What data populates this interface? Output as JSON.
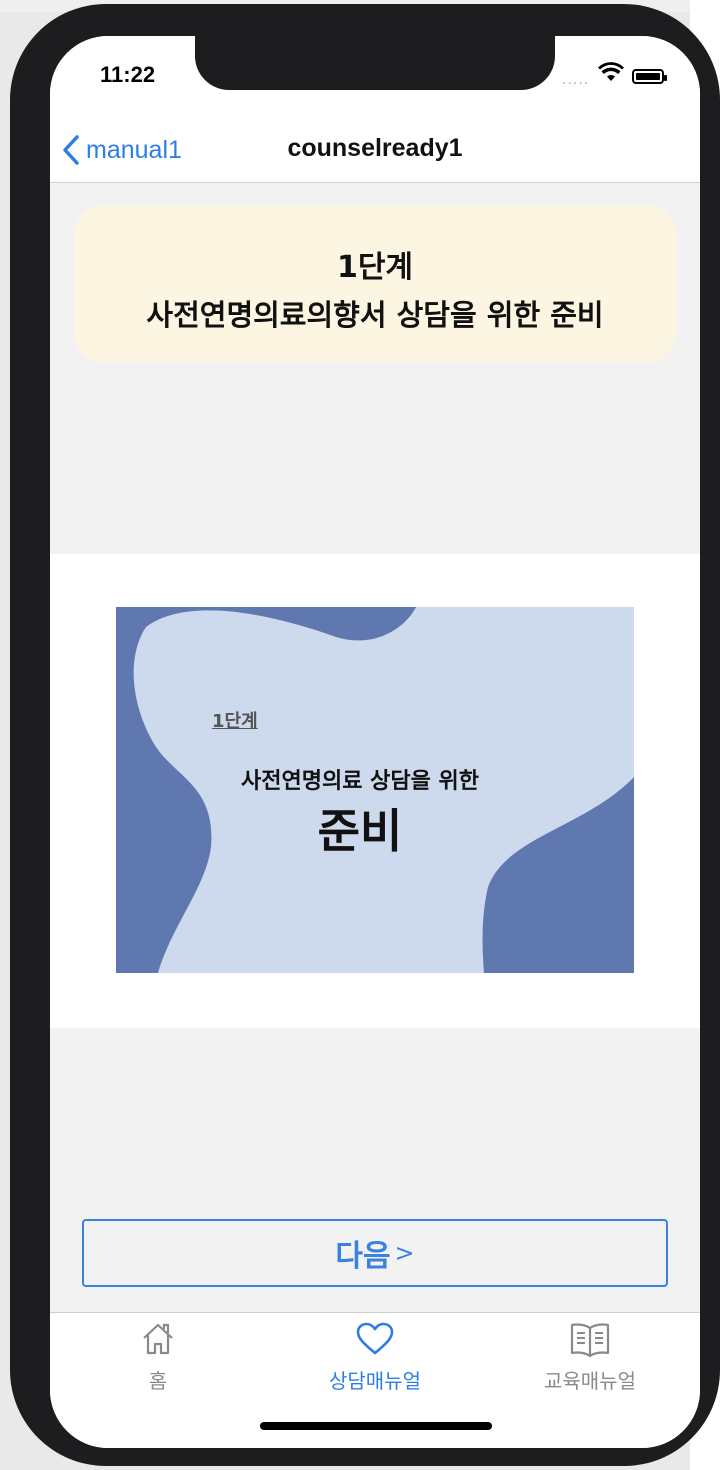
{
  "status": {
    "time": "11:22",
    "signal": "....."
  },
  "nav": {
    "back_label": "manual1",
    "title": "counselready1"
  },
  "header_card": {
    "line1": "1단계",
    "line2": "사전연명의료의향서 상담을 위한 준비"
  },
  "slide": {
    "step": "1단계",
    "subtitle": "사전연명의료 상담을 위한",
    "title": "준비",
    "colors": {
      "background": "#6078b0",
      "blob": "#cdd9ec"
    }
  },
  "next_button": {
    "label": "다음",
    "chevron": ">"
  },
  "tabs": [
    {
      "label": "홈",
      "icon": "house-icon",
      "active": false
    },
    {
      "label": "상담매뉴얼",
      "icon": "heart-icon",
      "active": true
    },
    {
      "label": "교육매뉴얼",
      "icon": "book-icon",
      "active": false
    }
  ],
  "colors": {
    "accent": "#2e7de6",
    "card_background": "#fbf5e2",
    "inactive_tab": "#8a8a8a"
  }
}
